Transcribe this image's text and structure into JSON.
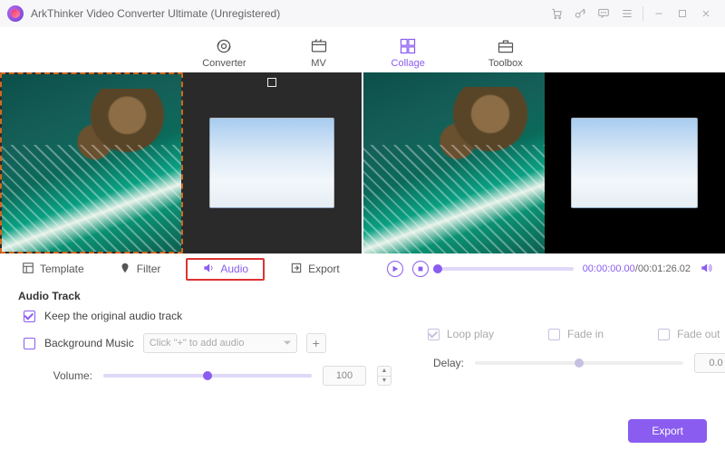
{
  "titlebar": {
    "title": "ArkThinker Video Converter Ultimate (Unregistered)"
  },
  "maintabs": {
    "converter": "Converter",
    "mv": "MV",
    "collage": "Collage",
    "toolbox": "Toolbox"
  },
  "undertabs": {
    "template": "Template",
    "filter": "Filter",
    "audio": "Audio",
    "export": "Export"
  },
  "playback": {
    "current": "00:00:00.00",
    "duration": "00:01:26.02"
  },
  "audio": {
    "section_label": "Audio Track",
    "keep_label": "Keep the original audio track",
    "bgm_label": "Background Music",
    "bgm_placeholder": "Click \"+\" to add audio",
    "volume_label": "Volume:",
    "volume_value": "100",
    "loop_label": "Loop play",
    "fadein_label": "Fade in",
    "fadeout_label": "Fade out",
    "delay_label": "Delay:",
    "delay_value": "0.0"
  },
  "footer": {
    "export": "Export"
  }
}
